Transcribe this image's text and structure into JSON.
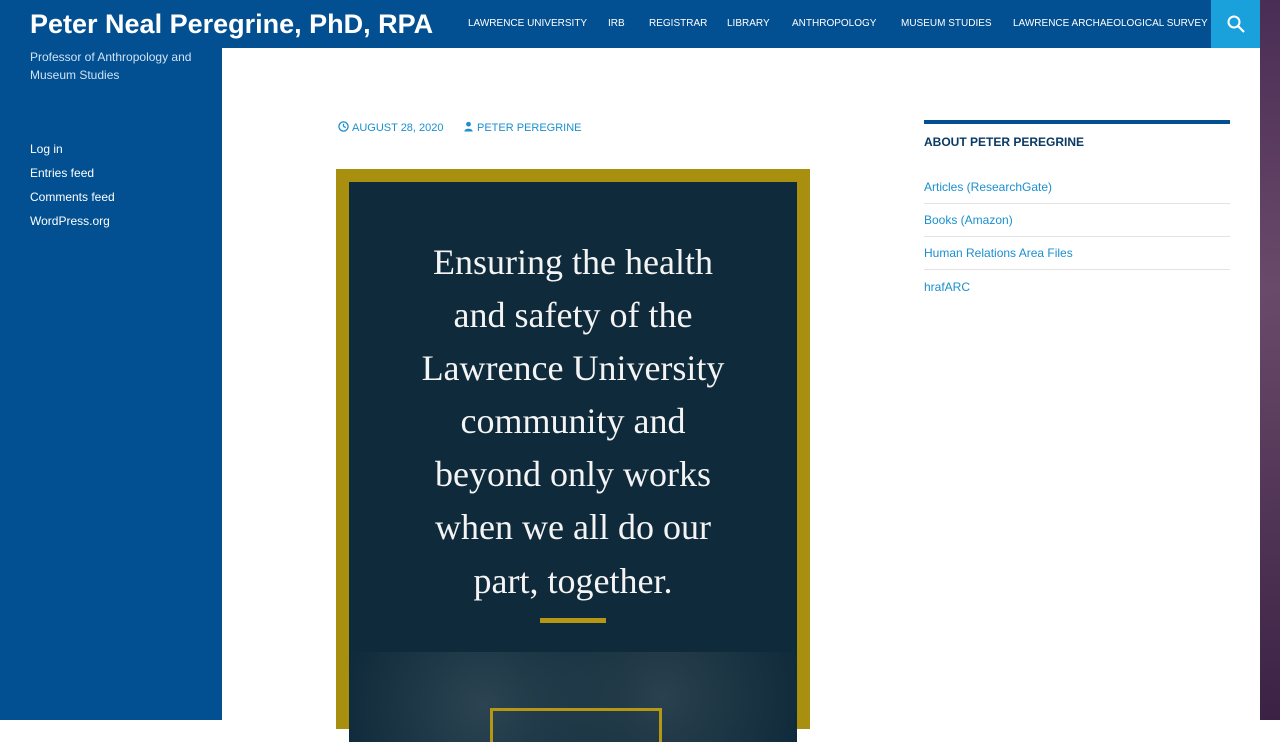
{
  "site": {
    "title": "Peter Neal Peregrine, PhD, RPA",
    "description": "Professor of Anthropology and Museum Studies"
  },
  "nav": {
    "items": [
      {
        "label": "Lawrence University"
      },
      {
        "label": "IRB"
      },
      {
        "label": "Registrar"
      },
      {
        "label": "Library"
      },
      {
        "label": "Anthropology"
      },
      {
        "label": "Museum Studies"
      },
      {
        "label": "Lawrence Archaeological Survey"
      }
    ],
    "search_icon": "search-icon"
  },
  "meta_links": {
    "items": [
      {
        "label": "Log in"
      },
      {
        "label": "Entries feed"
      },
      {
        "label": "Comments feed"
      },
      {
        "label": "WordPress.org"
      }
    ]
  },
  "post": {
    "date": "August 28, 2020",
    "author": "Peter Peregrine",
    "date_icon": "clock-icon",
    "author_icon": "person-icon",
    "poster_lines": [
      "Ensuring the health",
      "and safety of the",
      "Lawrence University",
      "community and",
      "beyond only works",
      "when we all do our",
      "part, together."
    ]
  },
  "widget": {
    "title": "About Peter Peregrine",
    "links": [
      {
        "label": "Articles (ResearchGate)"
      },
      {
        "label": "Books (Amazon)"
      },
      {
        "label": "Human Relations Area Files"
      },
      {
        "label": "hrafARC"
      }
    ]
  },
  "colors": {
    "brand_blue": "#024f92",
    "accent_cyan": "#1aa1dc",
    "link_blue": "#1b8fcf",
    "poster_gold": "#a98f10",
    "poster_dark": "#0f2a3a"
  }
}
